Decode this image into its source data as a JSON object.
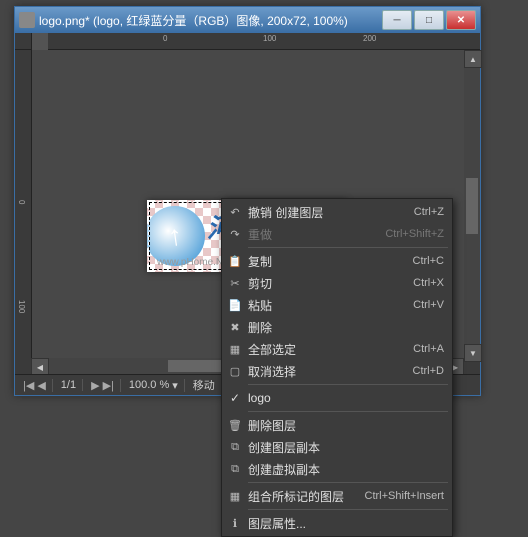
{
  "window": {
    "title": "logo.png* (logo, 红绿蓝分量（RGB）图像, 200x72, 100%)"
  },
  "ruler_h": [
    "0",
    "100",
    "200"
  ],
  "ruler_v": [
    "0",
    "100"
  ],
  "canvas": {
    "logo_text": "河",
    "domain_hint": "www.pHome.NET"
  },
  "statusbar": {
    "nav_first": "|◀",
    "nav_prev": "◀",
    "page": "1/1",
    "nav_next": "▶",
    "nav_last": "▶|",
    "zoom": "100.0 %",
    "tool": "移动"
  },
  "ctx": [
    {
      "type": "item",
      "icon": "↶",
      "label": "撤销 创建图层",
      "shortcut": "Ctrl+Z"
    },
    {
      "type": "item",
      "icon": "↷",
      "label": "重做",
      "shortcut": "Ctrl+Shift+Z",
      "disabled": true
    },
    {
      "type": "sep"
    },
    {
      "type": "item",
      "icon": "📋",
      "label": "复制",
      "shortcut": "Ctrl+C"
    },
    {
      "type": "item",
      "icon": "✂",
      "label": "剪切",
      "shortcut": "Ctrl+X"
    },
    {
      "type": "item",
      "icon": "📄",
      "label": "粘贴",
      "shortcut": "Ctrl+V"
    },
    {
      "type": "item",
      "icon": "✖",
      "label": "删除",
      "shortcut": ""
    },
    {
      "type": "item",
      "icon": "▦",
      "label": "全部选定",
      "shortcut": "Ctrl+A"
    },
    {
      "type": "item",
      "icon": "▢",
      "label": "取消选择",
      "shortcut": "Ctrl+D"
    },
    {
      "type": "sep"
    },
    {
      "type": "check",
      "checked": true,
      "label": "logo"
    },
    {
      "type": "sep"
    },
    {
      "type": "item",
      "icon": "🗑",
      "label": "删除图层",
      "shortcut": ""
    },
    {
      "type": "item",
      "icon": "⧉",
      "label": "创建图层副本",
      "shortcut": ""
    },
    {
      "type": "item",
      "icon": "⧉",
      "label": "创建虚拟副本",
      "shortcut": ""
    },
    {
      "type": "sep"
    },
    {
      "type": "item",
      "icon": "▦",
      "label": "组合所标记的图层",
      "shortcut": "Ctrl+Shift+Insert"
    },
    {
      "type": "sep"
    },
    {
      "type": "item",
      "icon": "ℹ",
      "label": "图层属性...",
      "shortcut": ""
    }
  ]
}
